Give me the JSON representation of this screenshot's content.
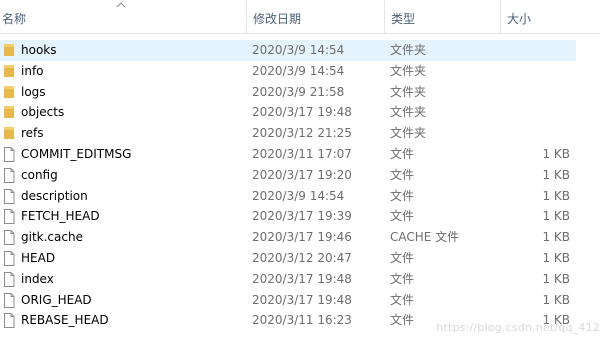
{
  "header": {
    "name": "名称",
    "date": "修改日期",
    "type": "类型",
    "size": "大小"
  },
  "rows": [
    {
      "name": "hooks",
      "date": "2020/3/9 14:54",
      "type": "文件夹",
      "size": "",
      "icon": "folder-icon",
      "selected": true
    },
    {
      "name": "info",
      "date": "2020/3/9 14:54",
      "type": "文件夹",
      "size": "",
      "icon": "folder-icon"
    },
    {
      "name": "logs",
      "date": "2020/3/9 21:58",
      "type": "文件夹",
      "size": "",
      "icon": "folder-icon"
    },
    {
      "name": "objects",
      "date": "2020/3/17 19:48",
      "type": "文件夹",
      "size": "",
      "icon": "folder-icon"
    },
    {
      "name": "refs",
      "date": "2020/3/12 21:25",
      "type": "文件夹",
      "size": "",
      "icon": "folder-icon"
    },
    {
      "name": "COMMIT_EDITMSG",
      "date": "2020/3/11 17:07",
      "type": "文件",
      "size": "1 KB",
      "icon": "file-icon"
    },
    {
      "name": "config",
      "date": "2020/3/17 19:20",
      "type": "文件",
      "size": "1 KB",
      "icon": "file-icon"
    },
    {
      "name": "description",
      "date": "2020/3/9 14:54",
      "type": "文件",
      "size": "1 KB",
      "icon": "file-icon"
    },
    {
      "name": "FETCH_HEAD",
      "date": "2020/3/17 19:39",
      "type": "文件",
      "size": "1 KB",
      "icon": "file-icon"
    },
    {
      "name": "gitk.cache",
      "date": "2020/3/17 19:46",
      "type": "CACHE 文件",
      "size": "1 KB",
      "icon": "file-icon"
    },
    {
      "name": "HEAD",
      "date": "2020/3/12 20:47",
      "type": "文件",
      "size": "1 KB",
      "icon": "file-icon"
    },
    {
      "name": "index",
      "date": "2020/3/17 19:48",
      "type": "文件",
      "size": "1 KB",
      "icon": "file-icon"
    },
    {
      "name": "ORIG_HEAD",
      "date": "2020/3/17 19:48",
      "type": "文件",
      "size": "1 KB",
      "icon": "file-icon"
    },
    {
      "name": "REBASE_HEAD",
      "date": "2020/3/11 16:23",
      "type": "文件",
      "size": "1 KB",
      "icon": "file-icon"
    }
  ],
  "watermark": "https://blog.csdn.net/qq_412",
  "colors": {
    "header_text": "#4c607a",
    "selected_bg": "#e5f3ff",
    "folder": "#e8b84b",
    "secondary_text": "#6d6d6d"
  }
}
